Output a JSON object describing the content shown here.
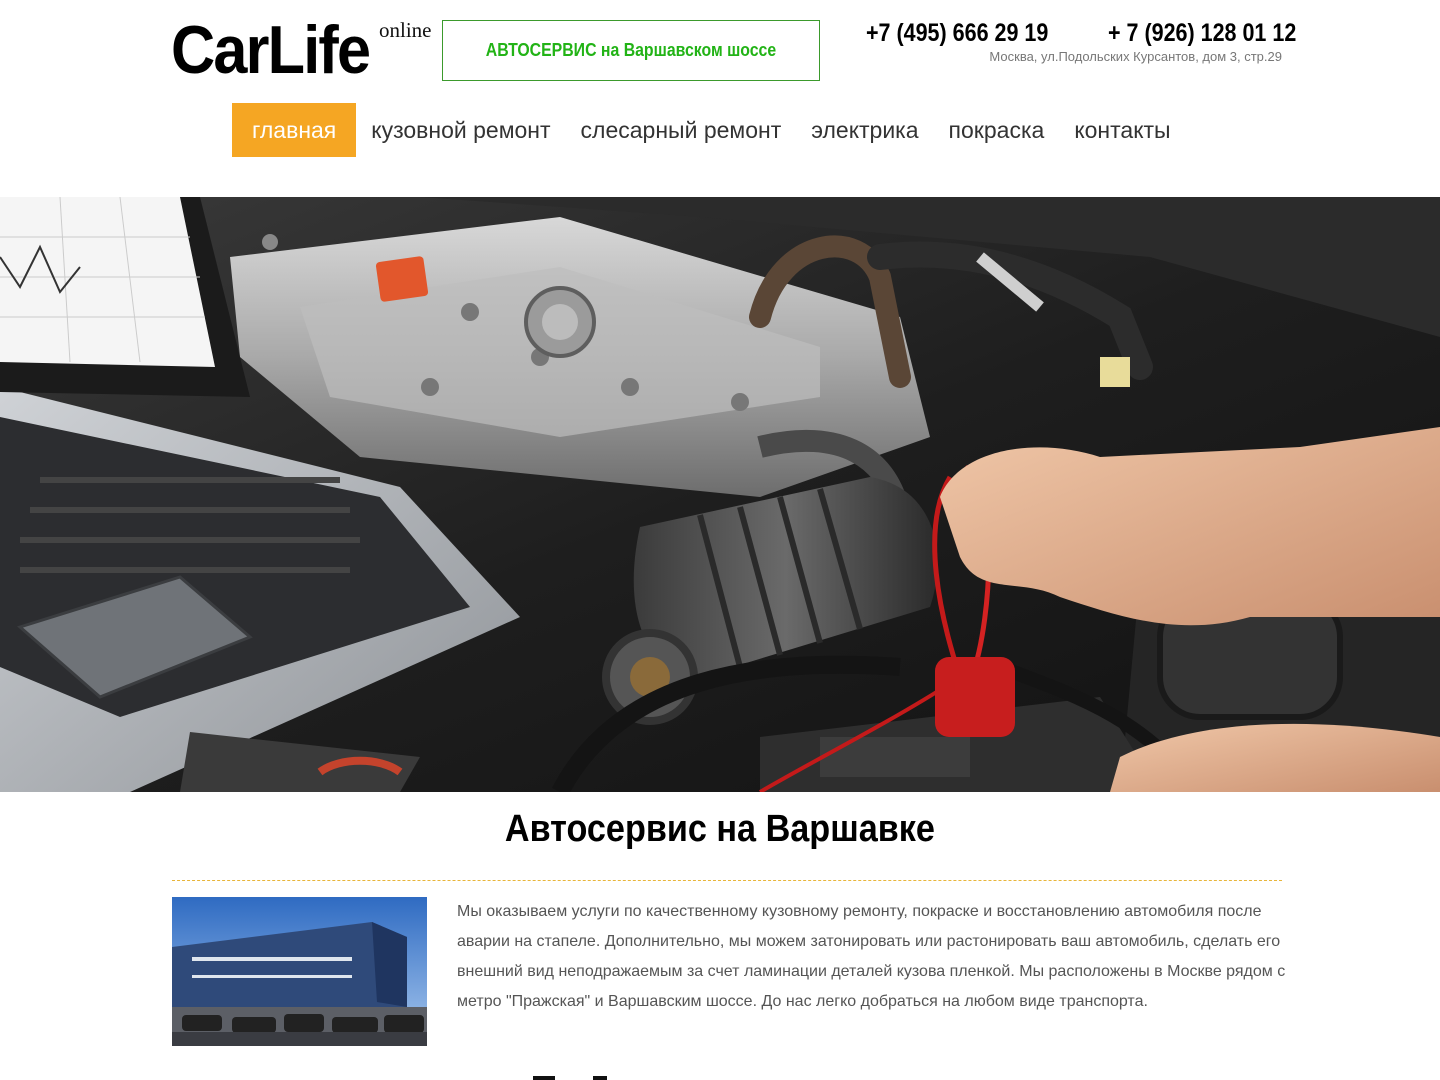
{
  "header": {
    "logo_text": "CarLife",
    "logo_sup": "online",
    "slogan": "АВТОСЕРВИС на Варшавском шоссе",
    "phone1": "+7 (495) 666 29 19",
    "phone2": "+ 7 (926) 128 01 12",
    "address": "Москва, ул.Подольских Курсантов, дом 3, стр.29"
  },
  "nav": {
    "items": [
      {
        "label": "главная",
        "active": true
      },
      {
        "label": "кузовной ремонт",
        "active": false
      },
      {
        "label": "слесарный ремонт",
        "active": false
      },
      {
        "label": "электрика",
        "active": false
      },
      {
        "label": "покраска",
        "active": false
      },
      {
        "label": "контакты",
        "active": false
      }
    ]
  },
  "main": {
    "title": "Автосервис на Варшавке",
    "text": "Мы оказываем услуги по качественному кузовному ремонту, покраске и восстановлению автомобиля после аварии на стапеле. Дополнительно, мы можем затонировать или растонировать ваш автомобиль, сделать его внешний вид неподражаемым за счет ламинации деталей кузова пленкой. Мы расположены в Москве рядом с метро \"Пражская\" и Варшавским шоссе. До нас легко добраться на любом виде транспорта."
  },
  "colors": {
    "accent": "#f5a623",
    "slogan_green": "#22b316",
    "divider": "#e8b53a"
  }
}
